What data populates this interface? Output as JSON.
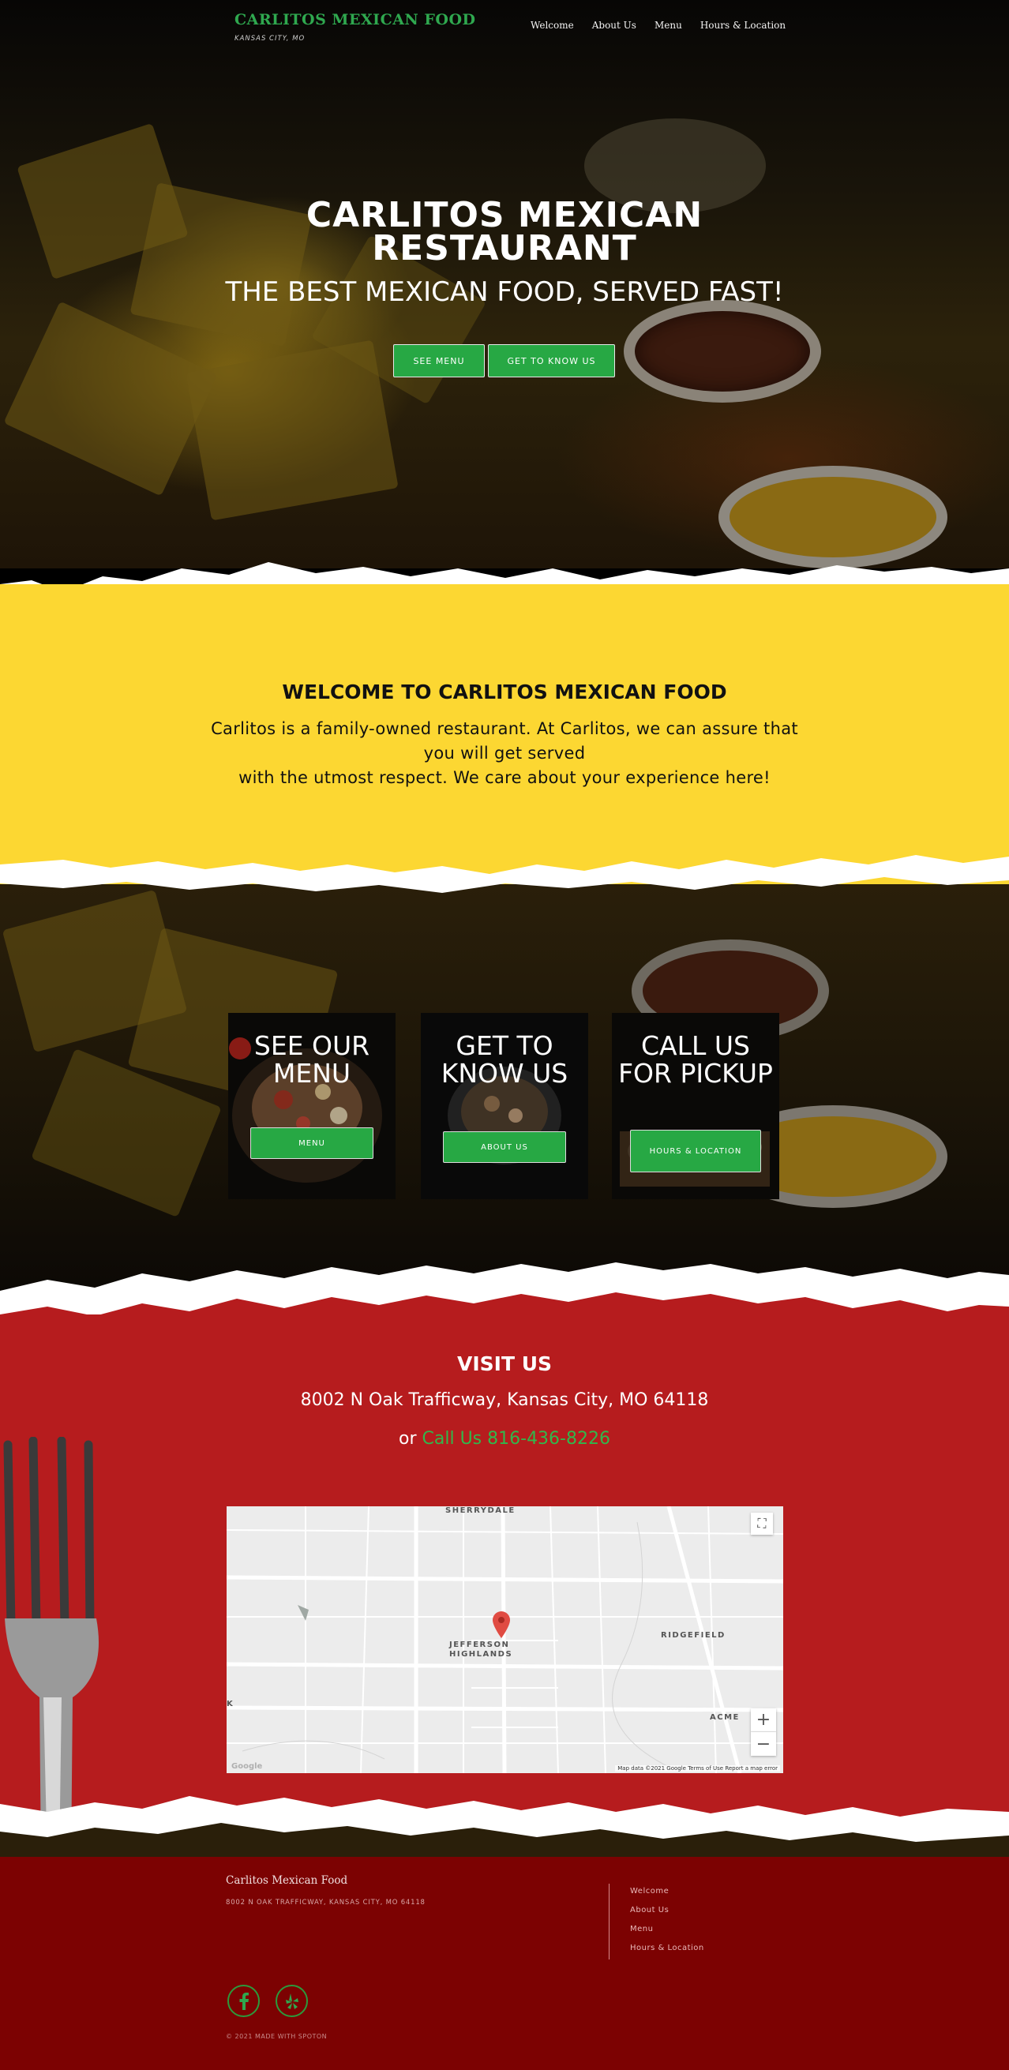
{
  "header": {
    "brand": "CARLITOS MEXICAN FOOD",
    "location": "KANSAS CITY, MO",
    "nav": [
      "Welcome",
      "About Us",
      "Menu",
      "Hours & Location"
    ]
  },
  "hero": {
    "title": "CARLITOS MEXICAN RESTAURANT",
    "subtitle": "THE BEST MEXICAN FOOD, SERVED FAST!",
    "buttons": [
      "SEE MENU",
      "GET TO KNOW US"
    ]
  },
  "welcome": {
    "title": "WELCOME TO CARLITOS MEXICAN FOOD",
    "line1": "Carlitos is a family-owned restaurant. At Carlitos, we can assure that you will get served",
    "line2": "with the utmost respect. We care about your experience here!"
  },
  "cards": [
    {
      "title": "SEE OUR MENU",
      "button": "MENU"
    },
    {
      "title": "GET TO KNOW US",
      "button": "ABOUT US"
    },
    {
      "title": "CALL US FOR PICKUP",
      "button": "HOURS & LOCATION"
    }
  ],
  "visit": {
    "title": "VISIT US",
    "address": "8002 N Oak Trafficway, Kansas City, MO 64118",
    "call_prefix": "or",
    "call_link": "Call Us 816-436-8226"
  },
  "map": {
    "labels": {
      "sherrydale": "SHERRYDALE",
      "jefferson": "JEFFERSON",
      "highlands": "HIGHLANDS",
      "ridgefield": "RIDGEFIELD",
      "acme": "ACME",
      "edge": "K"
    },
    "zoom_in": "+",
    "zoom_out": "−",
    "fullscreen": "⛶",
    "attribution": "Map data ©2021 Google   Terms of Use   Report a map error",
    "logo": "Google"
  },
  "footer": {
    "name": "Carlitos Mexican Food",
    "address": "8002 N OAK TRAFFICWAY, KANSAS CITY, MO 64118",
    "links": [
      "Welcome",
      "About Us",
      "Menu",
      "Hours & Location"
    ],
    "copyright": "© 2021 MADE WITH SPOTON",
    "social": [
      "facebook-icon",
      "yelp-icon"
    ]
  },
  "colors": {
    "accent_green": "#27a844",
    "yellow": "#fcd732",
    "red": "#b61c1e",
    "footer_red": "#7c0202"
  }
}
